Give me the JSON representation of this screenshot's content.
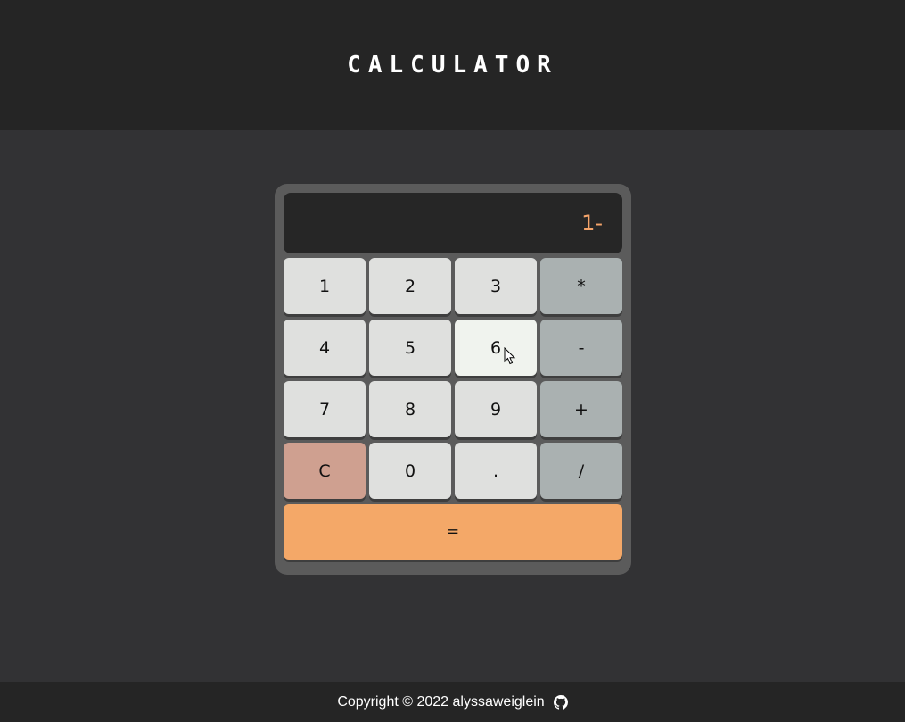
{
  "header": {
    "title": "CALCULATOR"
  },
  "display": {
    "value": "1-"
  },
  "keypad": {
    "k1": "1",
    "k2": "2",
    "k3": "3",
    "mul": "*",
    "k4": "4",
    "k5": "5",
    "k6": "6",
    "sub": "-",
    "k7": "7",
    "k8": "8",
    "k9": "9",
    "add": "+",
    "clear": "C",
    "k0": "0",
    "dot": ".",
    "div": "/",
    "equals": "="
  },
  "footer": {
    "copyright": "Copyright © 2022 alyssaweiglein",
    "icon": "github-icon"
  },
  "colors": {
    "header_bg": "#252525",
    "page_bg": "#323234",
    "calc_bg": "#5b5b5b",
    "display_text": "#f4a46a",
    "equals_bg": "#f4a868",
    "clear_bg": "#cfa090",
    "operator_bg": "#aab1b1",
    "number_bg": "#dfe0de"
  }
}
